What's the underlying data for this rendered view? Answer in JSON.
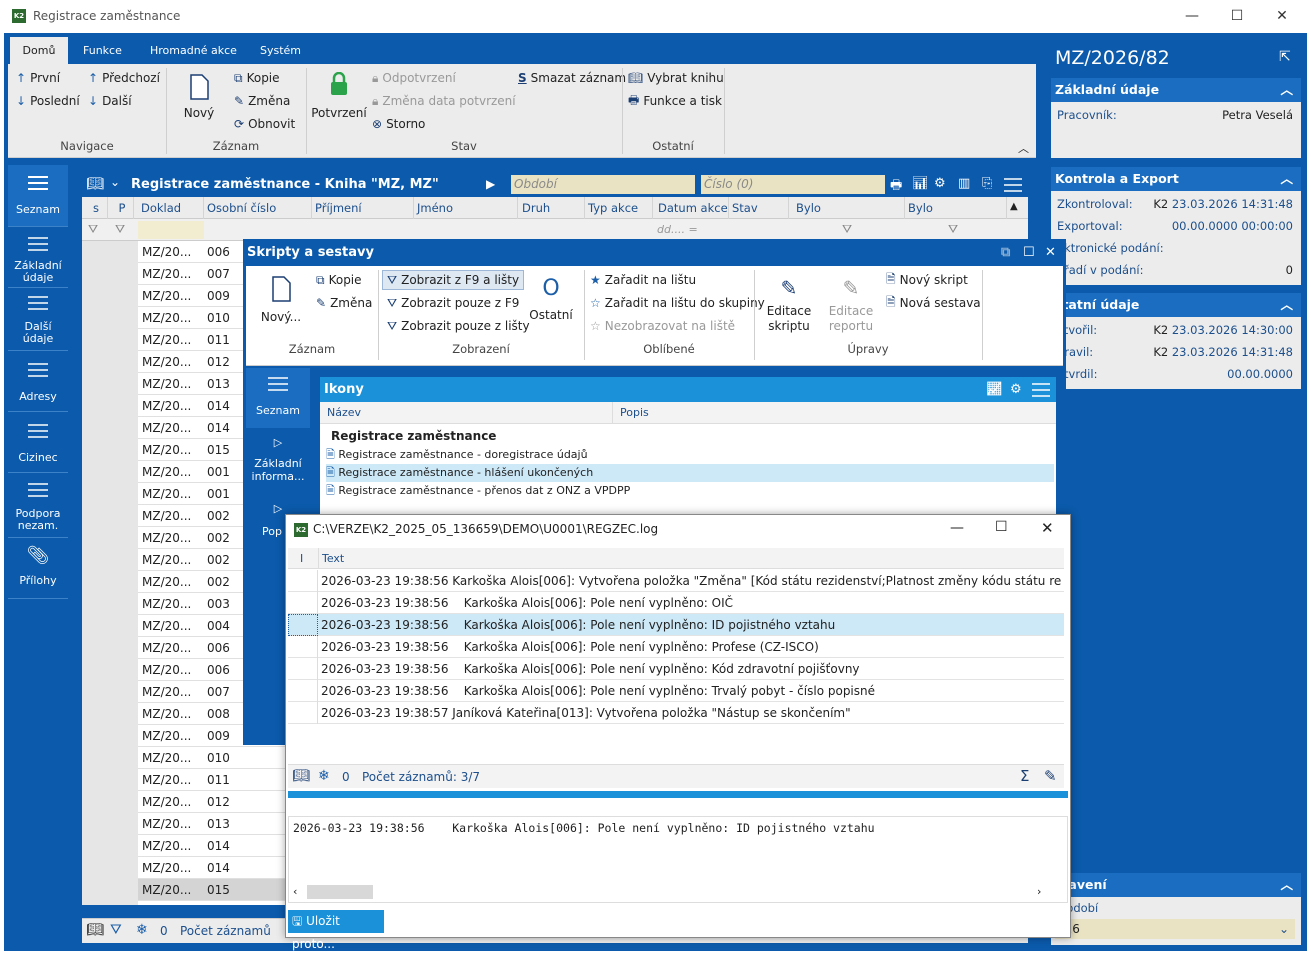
{
  "window": {
    "title": "Registrace zaměstnance"
  },
  "ribbon": {
    "tabs": [
      "Domů",
      "Funkce",
      "Hromadné akce",
      "Systém"
    ],
    "nav": {
      "first": "První",
      "prev": "Předchozí",
      "last": "Poslední",
      "next": "Další",
      "label": "Navigace"
    },
    "record": {
      "new": "Nový",
      "copy": "Kopie",
      "change": "Změna",
      "refresh": "Obnovit",
      "label": "Záznam"
    },
    "state": {
      "confirm": "Potvrzení",
      "unconfirm": "Odpotvrzení",
      "change_date": "Změna data potvrzení",
      "storno": "Storno",
      "delete": "Smazat záznam",
      "label": "Stav"
    },
    "other": {
      "choose_book": "Vybrat knihu",
      "functions_print": "Funkce a tisk",
      "label": "Ostatní"
    }
  },
  "leftnav": [
    {
      "label": "Seznam"
    },
    {
      "label": "Základní údaje"
    },
    {
      "label": "Další údaje"
    },
    {
      "label": "Adresy"
    },
    {
      "label": "Cizinec"
    },
    {
      "label": "Podpora nezam."
    },
    {
      "label": "Přílohy"
    }
  ],
  "list": {
    "title": "Registrace zaměstnance - Kniha \"MZ, MZ\"",
    "period_placeholder": "Období",
    "number_placeholder": "Číslo (0)",
    "columns": [
      "s",
      "P",
      "Doklad",
      "Osobní číslo",
      "Příjmení",
      "Jméno",
      "Druh činno",
      "Typ akce",
      "Datum akce",
      "Stav",
      "Bylo zkontrolováno",
      "Bylo exportováno"
    ],
    "date_filter": "dd.... =",
    "rows": [
      {
        "doc": "MZ/20...",
        "num": "006"
      },
      {
        "doc": "MZ/20...",
        "num": "007"
      },
      {
        "doc": "MZ/20...",
        "num": "009"
      },
      {
        "doc": "MZ/20...",
        "num": "010"
      },
      {
        "doc": "MZ/20...",
        "num": "011"
      },
      {
        "doc": "MZ/20...",
        "num": "012"
      },
      {
        "doc": "MZ/20...",
        "num": "013"
      },
      {
        "doc": "MZ/20...",
        "num": "014"
      },
      {
        "doc": "MZ/20...",
        "num": "014"
      },
      {
        "doc": "MZ/20...",
        "num": "015"
      },
      {
        "doc": "MZ/20...",
        "num": "001"
      },
      {
        "doc": "MZ/20...",
        "num": "001"
      },
      {
        "doc": "MZ/20...",
        "num": "002"
      },
      {
        "doc": "MZ/20...",
        "num": "002"
      },
      {
        "doc": "MZ/20...",
        "num": "002"
      },
      {
        "doc": "MZ/20...",
        "num": "002"
      },
      {
        "doc": "MZ/20...",
        "num": "003"
      },
      {
        "doc": "MZ/20...",
        "num": "004"
      },
      {
        "doc": "MZ/20...",
        "num": "006"
      },
      {
        "doc": "MZ/20...",
        "num": "006"
      },
      {
        "doc": "MZ/20...",
        "num": "007"
      },
      {
        "doc": "MZ/20...",
        "num": "008"
      },
      {
        "doc": "MZ/20...",
        "num": "009"
      },
      {
        "doc": "MZ/20...",
        "num": "010"
      },
      {
        "doc": "MZ/20...",
        "num": "011"
      },
      {
        "doc": "MZ/20...",
        "num": "012"
      },
      {
        "doc": "MZ/20...",
        "num": "013"
      },
      {
        "doc": "MZ/20...",
        "num": "014"
      },
      {
        "doc": "MZ/20...",
        "num": "014"
      },
      {
        "doc": "MZ/20...",
        "num": "015"
      }
    ],
    "footer": {
      "count_value": "0",
      "count_label": "Počet záznamů"
    }
  },
  "right": {
    "doc_id": "MZ/2026/82",
    "basic": {
      "title": "Základní údaje",
      "worker_label": "Pracovník:",
      "worker_value": "Petra Veselá"
    },
    "control": {
      "title": "Kontrola a Export",
      "checked_label": "Zkontroloval:",
      "checked_user": "K2",
      "checked_value": "23.03.2026 14:31:48",
      "exported_label": "Exportoval:",
      "exported_value": "00.00.0000 00:00:00",
      "epodani_label": "ektronické podání:",
      "order_label": "ořadí v podání:",
      "order_value": "0"
    },
    "other": {
      "title": "statní údaje",
      "created_label": "ytvořil:",
      "created_user": "K2",
      "created_value": "23.03.2026 14:30:00",
      "edited_label": "pravil:",
      "edited_user": "K2",
      "edited_value": "23.03.2026 14:31:48",
      "confirmed_label": "otvrdil:",
      "confirmed_value": "00.00.0000"
    },
    "settings": {
      "title": "stavení",
      "period_label": "Období",
      "period_value": "026"
    }
  },
  "scripts": {
    "title": "Skripty a sestavy",
    "record": {
      "new": "Nový...",
      "copy": "Kopie",
      "change": "Změna",
      "label": "Záznam"
    },
    "view": {
      "f9_and_bars": "Zobrazit z F9 a lišty",
      "f9_only": "Zobrazit pouze z F9",
      "bars_only": "Zobrazit pouze z lišty",
      "other": "Ostatní",
      "label": "Zobrazení"
    },
    "fav": {
      "add_bar": "Zařadit na lištu",
      "add_group": "Zařadit na lištu do skupiny",
      "hide": "Nezobrazovat na liště",
      "label": "Oblíbené"
    },
    "edit": {
      "script_edit": "Editace skriptu",
      "report_edit": "Editace reportu",
      "new_script": "Nový skript",
      "new_report": "Nová sestava",
      "label": "Úpravy"
    },
    "nav": [
      {
        "label": "Seznam"
      },
      {
        "label": "Základní informa..."
      },
      {
        "label": "Pop"
      }
    ],
    "list_title": "Ikony",
    "col_name": "Název",
    "col_desc": "Popis",
    "group": "Registrace zaměstnance",
    "items": [
      "Registrace zaměstnance - doregistrace údajů",
      "Registrace zaměstnance - hlášení ukončených",
      "Registrace zaměstnance - přenos dat z ONZ a VPDPP"
    ]
  },
  "log": {
    "title": "C:\\VERZE\\K2_2025_05_136659\\DEMO\\U0001\\REGZEC.log",
    "col_i": "I",
    "col_text": "Text",
    "rows": [
      "2026-03-23 19:38:56 Karkoška Alois[006]: Vytvořena položka \"Změna\" [Kód státu rezidenství;Platnost změny kódu státu rezide...",
      "2026-03-23 19:38:56    Karkoška Alois[006]: Pole není vyplněno: OIČ",
      "2026-03-23 19:38:56    Karkoška Alois[006]: Pole není vyplněno: ID pojistného vztahu",
      "2026-03-23 19:38:56    Karkoška Alois[006]: Pole není vyplněno: Profese (CZ-ISCO)",
      "2026-03-23 19:38:56    Karkoška Alois[006]: Pole není vyplněno: Kód zdravotní pojišťovny",
      "2026-03-23 19:38:56    Karkoška Alois[006]: Pole není vyplněno: Trvalý pobyt - číslo popisné",
      "2026-03-23 19:38:57 Janíková Kateřina[013]: Vytvořena položka \"Nástup se skončením\""
    ],
    "count_value": "0",
    "count_label": "Počet záznamů: 3/7",
    "detail": "2026-03-23 19:38:56    Karkoška Alois[006]: Pole není vyplněno: ID pojistného vztahu",
    "save": "Uložit proto..."
  },
  "colors": {
    "brand": "#0b5aab",
    "accent": "#1a6dc0",
    "selected": "#cde8f7"
  }
}
